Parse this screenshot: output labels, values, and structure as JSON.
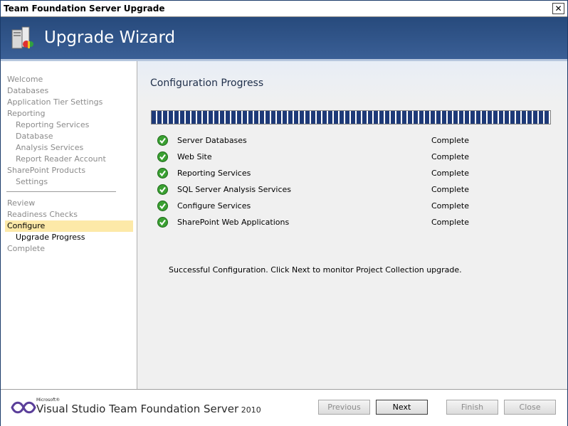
{
  "window": {
    "title": "Team Foundation Server Upgrade",
    "close_glyph": "✕"
  },
  "banner": {
    "title": "Upgrade Wizard",
    "icon": "server-install-icon"
  },
  "nav": {
    "items": [
      {
        "label": "Welcome",
        "level": 0,
        "state": "done"
      },
      {
        "label": "Databases",
        "level": 0,
        "state": "done"
      },
      {
        "label": "Application Tier Settings",
        "level": 0,
        "state": "done"
      },
      {
        "label": "Reporting",
        "level": 0,
        "state": "done"
      },
      {
        "label": "Reporting Services",
        "level": 1,
        "state": "done"
      },
      {
        "label": "Database",
        "level": 1,
        "state": "done"
      },
      {
        "label": "Analysis Services",
        "level": 1,
        "state": "done"
      },
      {
        "label": "Report Reader Account",
        "level": 1,
        "state": "done"
      },
      {
        "label": "SharePoint Products",
        "level": 0,
        "state": "done"
      },
      {
        "label": "Settings",
        "level": 1,
        "state": "done"
      },
      {
        "label": "Review",
        "level": 0,
        "state": "done"
      },
      {
        "label": "Readiness Checks",
        "level": 0,
        "state": "done"
      },
      {
        "label": "Configure",
        "level": 0,
        "state": "active"
      },
      {
        "label": "Upgrade Progress",
        "level": 1,
        "state": "current"
      },
      {
        "label": "Complete",
        "level": 0,
        "state": "pending"
      }
    ]
  },
  "main": {
    "heading": "Configuration Progress",
    "progress_fraction": 1.0,
    "tasks": [
      {
        "name": "Server Databases",
        "status": "Complete"
      },
      {
        "name": "Web Site",
        "status": "Complete"
      },
      {
        "name": "Reporting Services",
        "status": "Complete"
      },
      {
        "name": "SQL Server Analysis Services",
        "status": "Complete"
      },
      {
        "name": "Configure Services",
        "status": "Complete"
      },
      {
        "name": "SharePoint Web Applications",
        "status": "Complete"
      }
    ],
    "message": "Successful Configuration. Click Next to monitor Project Collection upgrade."
  },
  "footer": {
    "brand_ms": "Microsoft®",
    "brand_main": "Visual Studio",
    "brand_rest": " Team Foundation Server",
    "brand_year": " 2010",
    "buttons": {
      "previous": "Previous",
      "next": "Next",
      "finish": "Finish",
      "close": "Close"
    }
  },
  "colors": {
    "banner": "#274a7c",
    "progress": "#1e3a78",
    "nav_active": "#fde9a8",
    "check": "#3aa032"
  }
}
